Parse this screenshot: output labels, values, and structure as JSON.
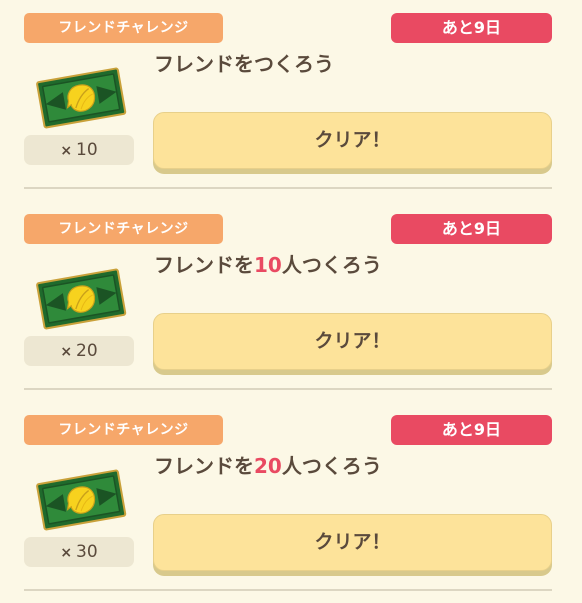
{
  "colors": {
    "background": "#fcf8e6",
    "category_tag": "#f6a76a",
    "deadline_tag": "#e94a62",
    "highlight_number": "#e94a62",
    "clear_button": "#fde39a",
    "quantity_badge": "#ede7d2"
  },
  "reward_icon": "nook-miles-ticket-icon",
  "challenges": [
    {
      "category": "フレンドチャレンジ",
      "deadline": "あと9日",
      "title_prefix": "フレンドを",
      "title_number": "",
      "title_suffix": "つくろう",
      "reward_x": "×",
      "reward_qty": "10",
      "button_label": "クリア！"
    },
    {
      "category": "フレンドチャレンジ",
      "deadline": "あと9日",
      "title_prefix": "フレンドを",
      "title_number": "10",
      "title_suffix": "人つくろう",
      "reward_x": "×",
      "reward_qty": "20",
      "button_label": "クリア！"
    },
    {
      "category": "フレンドチャレンジ",
      "deadline": "あと9日",
      "title_prefix": "フレンドを",
      "title_number": "20",
      "title_suffix": "人つくろう",
      "reward_x": "×",
      "reward_qty": "30",
      "button_label": "クリア！"
    }
  ]
}
